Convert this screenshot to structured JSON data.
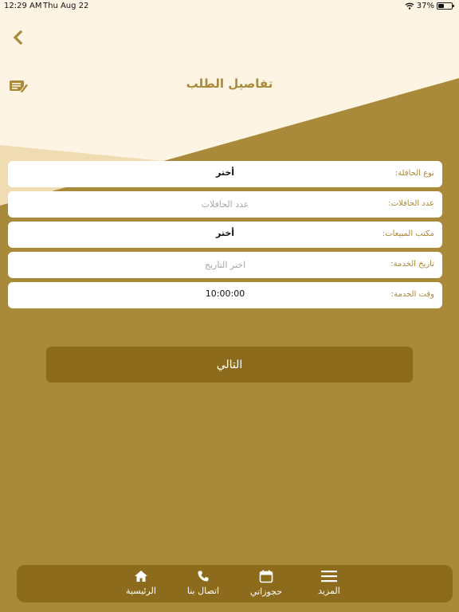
{
  "status_bar": {
    "time": "12:29 AM",
    "date": "Thu Aug 22",
    "battery": "37%"
  },
  "header": {
    "title": "تفاصيل الطلب",
    "back_icon": "chevron-left-icon",
    "edit_icon": "edit-note-icon"
  },
  "form": {
    "rows": [
      {
        "label": "نوع الحافلة:",
        "value": "أختر"
      },
      {
        "label": "عدد الحافلات:",
        "placeholder": "عدد الحافلات"
      },
      {
        "label": "مكتب المبيعات:",
        "value": "أختر"
      },
      {
        "label": "تاريخ الخدمة:",
        "placeholder": "اختر التاريخ"
      },
      {
        "label": "وقت الخدمة:",
        "value": "10:00:00"
      }
    ]
  },
  "next_button": {
    "label": "التالي"
  },
  "tab_bar": {
    "items": [
      {
        "label": "الرئيسية",
        "icon": "home-icon"
      },
      {
        "label": "اتصال بنا",
        "icon": "phone-icon"
      },
      {
        "label": "حجوزاتي",
        "icon": "calendar-icon"
      },
      {
        "label": "المزيد",
        "icon": "menu-icon"
      }
    ]
  },
  "colors": {
    "brand_gold": "#a98a3a",
    "dark_gold": "#8d6b1c",
    "cream": "#fdf4e3"
  }
}
